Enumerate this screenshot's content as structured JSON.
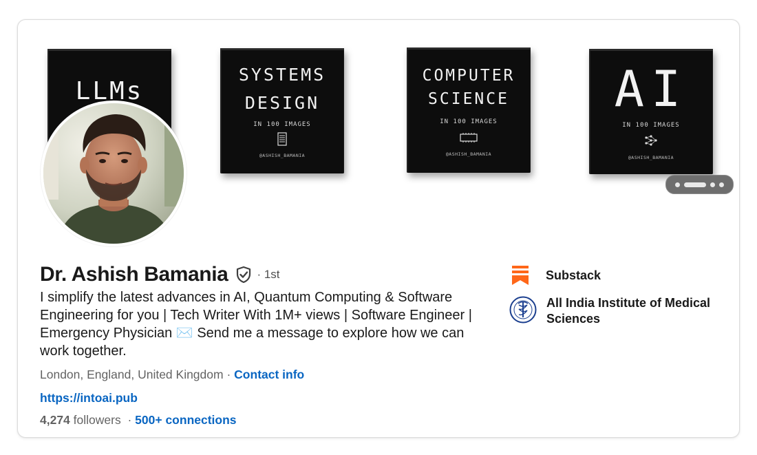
{
  "profile": {
    "name": "Dr. Ashish Bamania",
    "degree": "· 1st",
    "headline": "I simplify the latest advances in AI, Quantum Computing & Software Engineering for you | Tech Writer With 1M+ views | Software Engineer | Emergency Physician ✉️ Send me a message to explore how we can work together.",
    "location": "London, England, United Kingdom",
    "separator": "·",
    "contact_info": "Contact info",
    "website": "https://intoai.pub",
    "followers_count": "4,274",
    "followers_label": "followers",
    "connections": "500+ connections"
  },
  "banner": {
    "books": [
      {
        "title_lines": [
          "LLMs"
        ]
      },
      {
        "title_lines": [
          "SYSTEMS",
          "DESIGN"
        ],
        "subtitle": "IN 100 IMAGES",
        "handle": "@ASHISH_BAMANIA",
        "icon": "server-icon"
      },
      {
        "title_lines": [
          "COMPUTER",
          "SCIENCE"
        ],
        "subtitle": "IN 100 IMAGES",
        "handle": "@ASHISH_BAMANIA",
        "icon": "chip-icon"
      },
      {
        "title_lines": [
          "AI"
        ],
        "subtitle": "IN 100 IMAGES",
        "handle": "@ASHISH_BAMANIA",
        "icon": "neural-network-icon"
      }
    ]
  },
  "organizations": [
    {
      "name": "Substack",
      "icon": "substack-logo-icon",
      "color": "#ff6719"
    },
    {
      "name": "All India Institute of Medical Sciences",
      "icon": "aiims-seal-icon",
      "color": "#1b3f8f"
    }
  ],
  "colors": {
    "link": "#0a66c2",
    "text": "#191919",
    "muted": "#666666"
  }
}
